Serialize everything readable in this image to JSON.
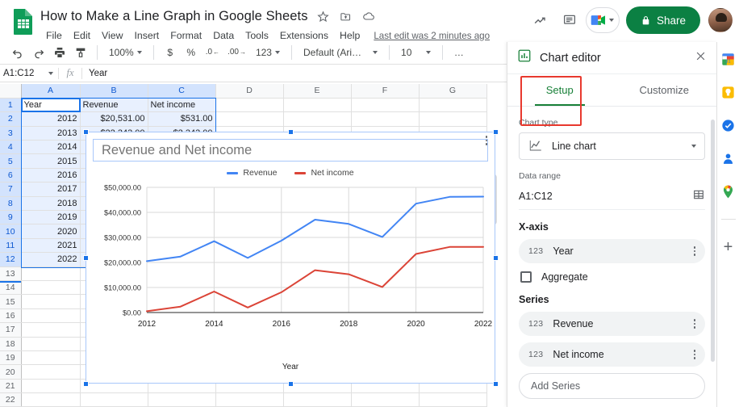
{
  "app": {
    "doc_title": "How to Make a Line Graph in Google Sheets",
    "last_edit": "Last edit was 2 minutes ago",
    "menus": [
      "File",
      "Edit",
      "View",
      "Insert",
      "Format",
      "Data",
      "Tools",
      "Extensions",
      "Help"
    ],
    "title_icons": [
      "star-icon",
      "move-to-folder-icon",
      "cloud-saved-icon"
    ],
    "share_label": "Share"
  },
  "toolbar": {
    "zoom": "100%",
    "currency": "$",
    "percent": "%",
    "decimal_decrease": ".0",
    "decimal_increase": ".00",
    "number_format": "123",
    "font": "Default (Ari…",
    "font_size": "10",
    "more": "…"
  },
  "formula_bar": {
    "name_box": "A1:C12",
    "fx": "fx",
    "value": "Year"
  },
  "sheet": {
    "columns": [
      "A",
      "B",
      "C",
      "D",
      "E",
      "F",
      "G"
    ],
    "selected_columns": [
      "A",
      "B",
      "C"
    ],
    "headers": [
      "Year",
      "Revenue",
      "Net income"
    ],
    "rows": [
      {
        "n": "1",
        "a": "Year",
        "b": "Revenue",
        "c": "Net income"
      },
      {
        "n": "2",
        "a": "2012",
        "b": "$20,531.00",
        "c": "$531.00"
      },
      {
        "n": "3",
        "a": "2013",
        "b": "$22,343.00",
        "c": "$2,343.00"
      },
      {
        "n": "4",
        "a": "2014",
        "b": "",
        "c": ""
      },
      {
        "n": "5",
        "a": "2015",
        "b": "",
        "c": ""
      },
      {
        "n": "6",
        "a": "2016",
        "b": "",
        "c": ""
      },
      {
        "n": "7",
        "a": "2017",
        "b": "",
        "c": ""
      },
      {
        "n": "8",
        "a": "2018",
        "b": "",
        "c": ""
      },
      {
        "n": "9",
        "a": "2019",
        "b": "",
        "c": ""
      },
      {
        "n": "10",
        "a": "2020",
        "b": "",
        "c": ""
      },
      {
        "n": "11",
        "a": "2021",
        "b": "",
        "c": ""
      },
      {
        "n": "12",
        "a": "2022",
        "b": "",
        "c": ""
      },
      {
        "n": "13",
        "a": "",
        "b": "",
        "c": ""
      },
      {
        "n": "14",
        "a": "",
        "b": "",
        "c": ""
      },
      {
        "n": "15",
        "a": "",
        "b": "",
        "c": ""
      },
      {
        "n": "16",
        "a": "",
        "b": "",
        "c": ""
      },
      {
        "n": "17",
        "a": "",
        "b": "",
        "c": ""
      },
      {
        "n": "18",
        "a": "",
        "b": "",
        "c": ""
      },
      {
        "n": "19",
        "a": "",
        "b": "",
        "c": ""
      },
      {
        "n": "20",
        "a": "",
        "b": "",
        "c": ""
      },
      {
        "n": "21",
        "a": "",
        "b": "",
        "c": ""
      },
      {
        "n": "22",
        "a": "",
        "b": "",
        "c": ""
      }
    ]
  },
  "chart_data": {
    "type": "line",
    "title": "Revenue and Net income",
    "xlabel": "Year",
    "ylabel": "",
    "x": [
      2012,
      2013,
      2014,
      2015,
      2016,
      2017,
      2018,
      2019,
      2020,
      2021,
      2022
    ],
    "xticks": [
      "2012",
      "2014",
      "2016",
      "2018",
      "2020",
      "2022"
    ],
    "yticks": [
      "$0.00",
      "$10,000.00",
      "$20,000.00",
      "$30,000.00",
      "$40,000.00",
      "$50,000.00"
    ],
    "ylim": [
      0,
      50000
    ],
    "grid": true,
    "legend_position": "top",
    "series": [
      {
        "name": "Revenue",
        "color": "#4285f4",
        "values": [
          20531,
          22343,
          28500,
          21800,
          28700,
          37100,
          35400,
          30200,
          43500,
          46200,
          46300
        ]
      },
      {
        "name": "Net income",
        "color": "#db4437",
        "values": [
          531,
          2343,
          8400,
          2000,
          8100,
          16900,
          15300,
          10200,
          23400,
          26200,
          26200
        ]
      }
    ]
  },
  "chart_editor": {
    "panel_title": "Chart editor",
    "panel_icon": "bar-chart-icon",
    "close_icon": "close-icon",
    "tabs": [
      {
        "label": "Setup",
        "active": true
      },
      {
        "label": "Customize",
        "active": false
      }
    ],
    "chart_type_label": "Chart type",
    "chart_type_value": "Line chart",
    "data_range_label": "Data range",
    "data_range_value": "A1:C12",
    "x_axis_label": "X-axis",
    "x_axis_value": "Year",
    "x_axis_badge": "123",
    "aggregate_label": "Aggregate",
    "aggregate_checked": false,
    "series_label": "Series",
    "series": [
      {
        "badge": "123",
        "name": "Revenue"
      },
      {
        "badge": "123",
        "name": "Net income"
      }
    ],
    "add_series_label": "Add Series"
  },
  "side_rail": {
    "icons": [
      "google-calendar-icon",
      "google-keep-icon",
      "google-tasks-icon",
      "google-contacts-icon",
      "google-maps-icon"
    ],
    "plus": "+"
  },
  "colors": {
    "revenue": "#4285f4",
    "net_income": "#db4437",
    "accent_green": "#188038",
    "share_green": "#0b8043",
    "selection_blue": "#1a73e8",
    "annotation_red": "#e8392e"
  }
}
